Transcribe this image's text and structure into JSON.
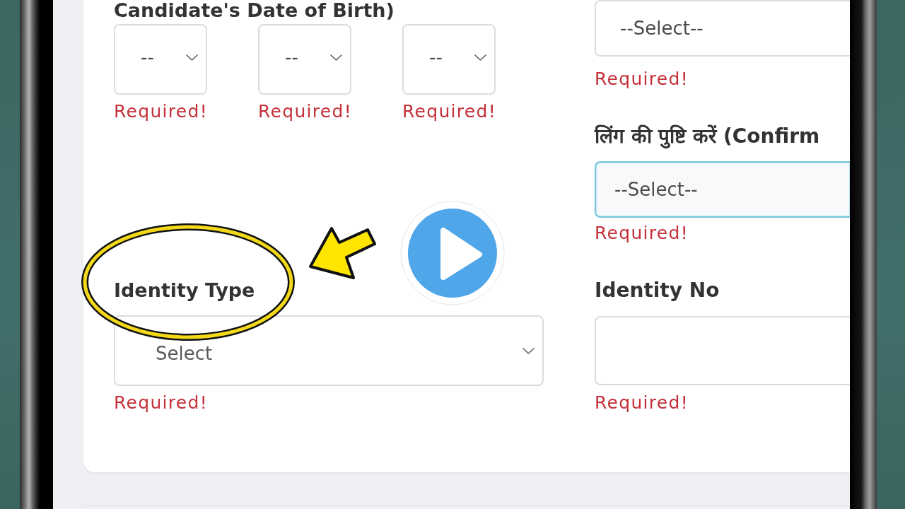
{
  "form_card": {
    "clipped_right": true,
    "top_row": {
      "date_of_birth": {
        "label": "Candidate's Date of Birth)",
        "parts": [
          {
            "value": "--",
            "error": "Required!"
          },
          {
            "value": "--",
            "error": "Required!"
          },
          {
            "value": "--",
            "error": "Required!"
          }
        ]
      },
      "fields": [
        {
          "kind": "select",
          "value": "--Select--",
          "focused": false,
          "error": "Required!"
        },
        {
          "kind": "select",
          "label": "लिंग की पुष्टि करें (Confirm",
          "value": "--Select--",
          "focused": true,
          "error": "Required!"
        }
      ]
    },
    "bottom_row": {
      "fields": [
        {
          "kind": "select",
          "label": "Identity Type",
          "value": "Select",
          "focused": false,
          "error": "Required!"
        },
        {
          "kind": "input",
          "label": "Identity No",
          "focused": false,
          "error": "Required!"
        }
      ]
    }
  },
  "overlays": [
    {
      "kind": "highlight_ellipse"
    },
    {
      "kind": "arrow"
    },
    {
      "kind": "play_button"
    }
  ]
}
